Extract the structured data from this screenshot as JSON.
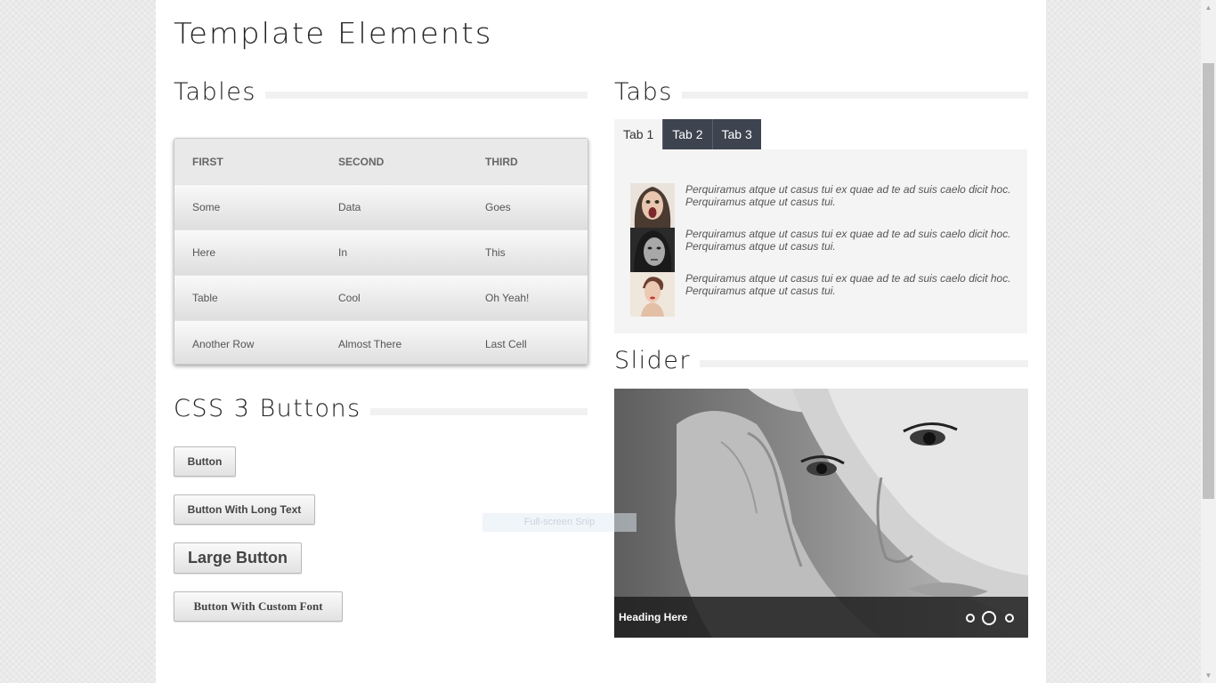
{
  "page": {
    "title": "Template Elements"
  },
  "tables": {
    "heading": "Tables",
    "columns": [
      "FIRST",
      "SECOND",
      "THIRD"
    ],
    "rows": [
      [
        "Some",
        "Data",
        "Goes"
      ],
      [
        "Here",
        "In",
        "This"
      ],
      [
        "Table",
        "Cool",
        "Oh Yeah!"
      ],
      [
        "Another Row",
        "Almost There",
        "Last Cell"
      ]
    ]
  },
  "buttons": {
    "heading": "CSS 3 Buttons",
    "button": "Button",
    "long_text": "Button With Long Text",
    "large": "Large Button",
    "custom_font": "Button With Custom Font"
  },
  "tabs": {
    "heading": "Tabs",
    "items": [
      "Tab 1",
      "Tab 2",
      "Tab 3"
    ],
    "active_index": 0,
    "content": [
      "Perquiramus atque ut casus tui ex quae ad te ad suis caelo dicit hoc. Perquiramus atque ut casus tui.",
      "Perquiramus atque ut casus tui ex quae ad te ad suis caelo dicit hoc. Perquiramus atque ut casus tui.",
      "Perquiramus atque ut casus tui ex quae ad te ad suis caelo dicit hoc. Perquiramus atque ut casus tui."
    ]
  },
  "slider": {
    "heading": "Slider",
    "caption": "Heading Here",
    "slide_count": 3,
    "active_slide": 2
  },
  "overlay": {
    "snip_label": "Full-screen Snip"
  },
  "colors": {
    "tab_dark": "#3d4450",
    "panel_bg": "#f4f4f4",
    "caption_bg": "#1e1e1e"
  }
}
